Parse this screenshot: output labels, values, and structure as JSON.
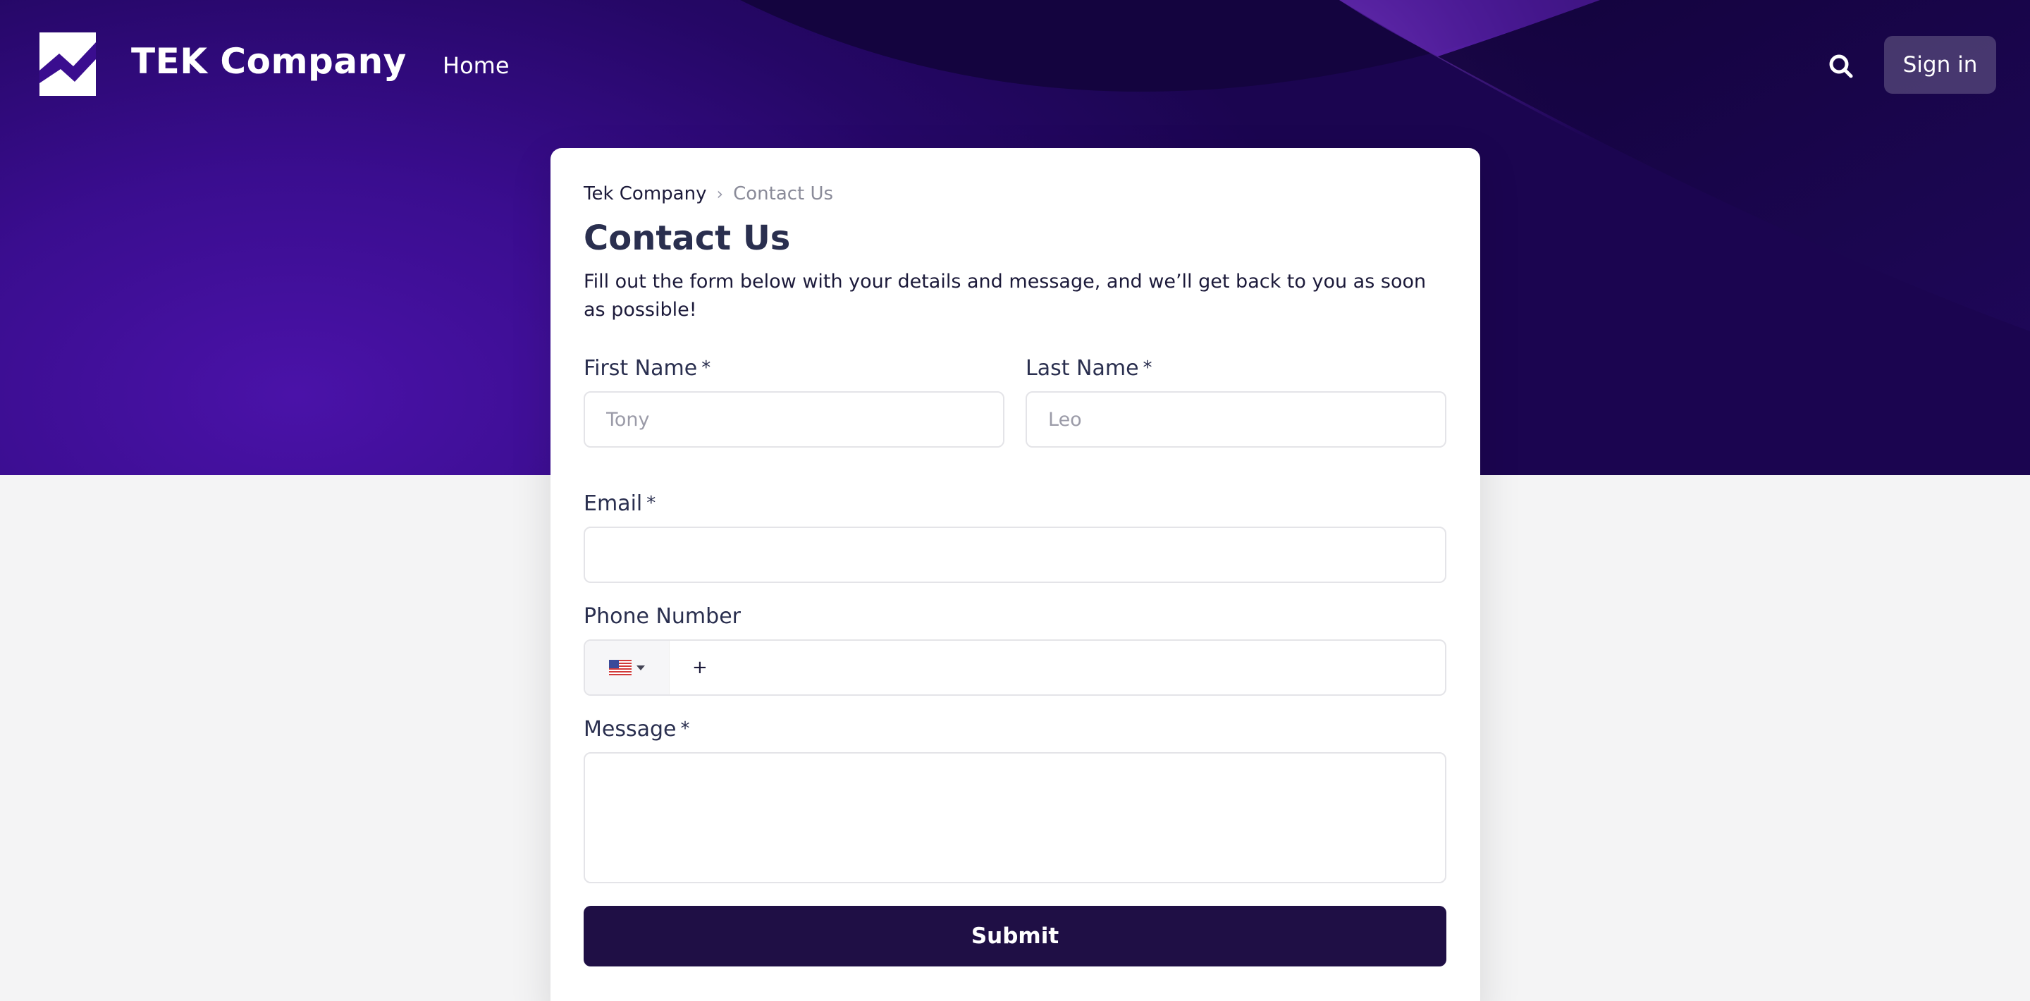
{
  "header": {
    "brand": "TEK Company",
    "nav": {
      "home": "Home"
    },
    "sign_in": "Sign in"
  },
  "breadcrumb": {
    "parent": "Tek Company",
    "separator": "›",
    "current": "Contact Us"
  },
  "page": {
    "title": "Contact Us",
    "intro": "Fill out the form below with your details and message, and we’ll get back to you as soon as possible!"
  },
  "form": {
    "first_name": {
      "label": "First Name",
      "required": "*",
      "placeholder": "Tony",
      "value": ""
    },
    "last_name": {
      "label": "Last Name",
      "required": "*",
      "placeholder": "Leo",
      "value": ""
    },
    "email": {
      "label": "Email",
      "required": "*",
      "value": ""
    },
    "phone": {
      "label": "Phone Number",
      "country": "US",
      "prefix": "+",
      "value": ""
    },
    "message": {
      "label": "Message",
      "required": "*",
      "value": ""
    },
    "submit": "Submit"
  },
  "colors": {
    "hero_primary": "#3a0d8f",
    "hero_dark": "#1b0550",
    "submit_bg": "#1f0f45",
    "title_text": "#2a2f4f"
  },
  "icons": {
    "logo": "tek-logo-icon",
    "search": "search-icon",
    "breadcrumb_separator": "chevron-right-icon",
    "country_flag": "us-flag-icon",
    "dropdown": "caret-down-icon"
  }
}
